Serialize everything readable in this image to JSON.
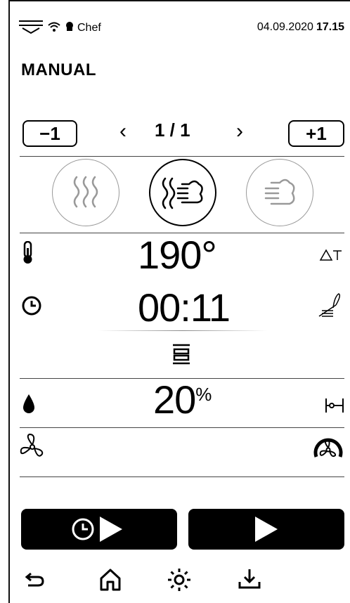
{
  "status": {
    "chef": "Chef",
    "date": "04.09.2020",
    "time": "17.15"
  },
  "page_title": "MANUAL",
  "steps": {
    "minus_label": "−1",
    "plus_label": "+1",
    "pager": "1 / 1",
    "prev": "‹",
    "next": "›"
  },
  "modes": [
    {
      "name": "steam",
      "selected": false
    },
    {
      "name": "combi",
      "selected": true
    },
    {
      "name": "convection",
      "selected": false
    }
  ],
  "temperature": {
    "value": "190°"
  },
  "timer": {
    "value": "00:11"
  },
  "humidity": {
    "value": "20",
    "unit": "%"
  },
  "colors": {
    "accent": "#000000",
    "muted": "#999999"
  }
}
